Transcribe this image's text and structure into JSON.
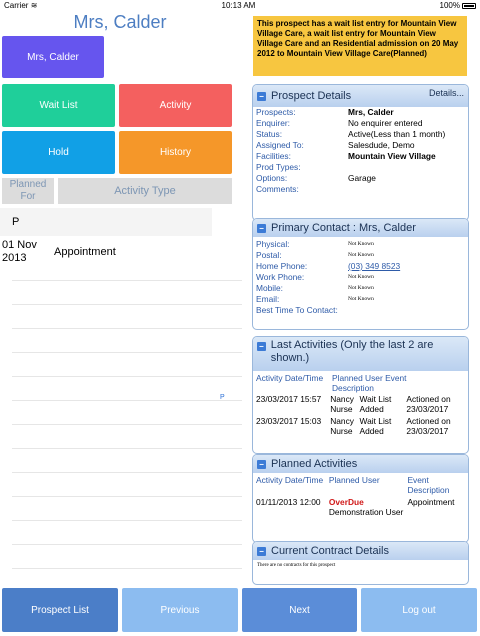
{
  "status_bar": {
    "carrier": "Carrier",
    "wifi_icon": "wifi-icon",
    "time": "10:13 AM",
    "battery": "100%"
  },
  "left": {
    "title": "Mrs, Calder",
    "name_button": "Mrs, Calder",
    "tiles": {
      "wait_list": "Wait List",
      "activity": "Activity",
      "hold": "Hold",
      "history": "History"
    },
    "headers": {
      "planned_for": "Planned For",
      "activity_type": "Activity Type"
    },
    "section_letter": "P",
    "rows": [
      {
        "date": "01 Nov 2013",
        "description": "Appointment"
      }
    ],
    "index_letter": "P"
  },
  "right": {
    "notice": "This prospect has a wait list entry for Mountain View Village Care, a wait list entry for Mountain View Village Care and an Residential admission on 20 May 2012 to Mountain View Village Care(Planned)",
    "prospect": {
      "title": "Prospect Details",
      "details_link": "Details...",
      "fields": [
        {
          "label": "Prospects:",
          "value": "Mrs, Calder"
        },
        {
          "label": "Enquirer:",
          "value": "No enquirer entered"
        },
        {
          "label": "Status:",
          "value": "Active(Less than 1 month)"
        },
        {
          "label": "Assigned To:",
          "value": "Salesdude, Demo"
        },
        {
          "label": "Facilities:",
          "value": "Mountain View Village"
        },
        {
          "label": "Prod Types:",
          "value": ""
        },
        {
          "label": "Options:",
          "value": "Garage"
        },
        {
          "label": "Comments:",
          "value": ""
        }
      ]
    },
    "contact": {
      "title": "Primary Contact : Mrs, Calder",
      "fields": [
        {
          "label": "Physical:",
          "value": "Not Known"
        },
        {
          "label": "Postal:",
          "value": "Not Known"
        },
        {
          "label": "Home Phone:",
          "value": "(03) 349 8523"
        },
        {
          "label": "Work Phone:",
          "value": "Not Known"
        },
        {
          "label": "Mobile:",
          "value": "Not Known"
        },
        {
          "label": "Email:",
          "value": "Not Known"
        },
        {
          "label": "Best Time To Contact:",
          "value": ""
        }
      ]
    },
    "last_activities": {
      "title": "Last Activities (Only the last 2 are shown.)",
      "headers": {
        "date": "Activity Date/Time",
        "planned": "Planned User",
        "event": "Event Description",
        "extra": ""
      },
      "rows": [
        {
          "date": "23/03/2017 15:57",
          "user": "Nancy Nurse",
          "event": "Wait List Added",
          "action": "Actioned on 23/03/2017"
        },
        {
          "date": "23/03/2017 15:03",
          "user": "Nancy Nurse",
          "event": "Wait List Added",
          "action": "Actioned on 23/03/2017"
        }
      ]
    },
    "planned_activities": {
      "title": "Planned Activities",
      "headers": {
        "date": "Activity Date/Time",
        "user": "Planned User",
        "event": "Event Description"
      },
      "rows": [
        {
          "date": "01/11/2013 12:00",
          "status": "OverDue",
          "user": "Demonstration User",
          "event": "Appointment"
        }
      ]
    },
    "contract": {
      "title": "Current Contract Details",
      "empty": "There are no contracts for this prospect"
    }
  },
  "bottom": {
    "prospect_list": "Prospect List",
    "previous": "Previous",
    "next": "Next",
    "logout": "Log out"
  }
}
